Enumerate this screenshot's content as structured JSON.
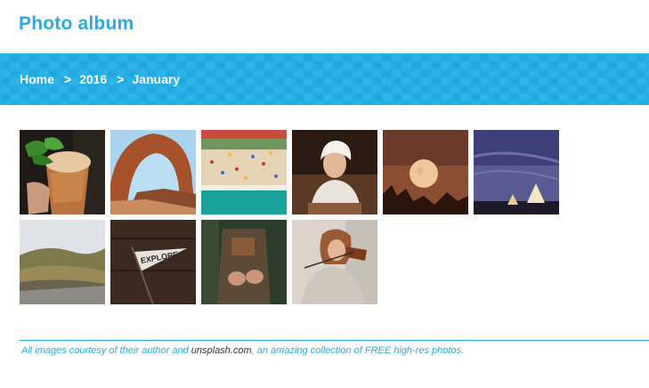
{
  "header": {
    "title": "Photo album"
  },
  "breadcrumb": {
    "items": [
      "Home",
      "2016",
      "January"
    ],
    "separator": ">"
  },
  "gallery": {
    "photos": [
      {
        "name": "photo-mint-drink-copper-mug"
      },
      {
        "name": "photo-desert-rock-arch"
      },
      {
        "name": "photo-aerial-beach"
      },
      {
        "name": "photo-woman-headscarf"
      },
      {
        "name": "photo-full-moon-trees"
      },
      {
        "name": "photo-teepee-night-sky"
      },
      {
        "name": "photo-mountain-valley-road"
      },
      {
        "name": "photo-explore-pennant"
      },
      {
        "name": "photo-leather-apron-crafting"
      },
      {
        "name": "photo-girl-violin"
      }
    ]
  },
  "footer": {
    "text_before": "All images courtesy of their author and ",
    "link": "unsplash.com",
    "text_after": ", an amazing collection of FREE high-res photos."
  },
  "colors": {
    "accent": "#2aaae2",
    "banner": "#25aee6"
  }
}
